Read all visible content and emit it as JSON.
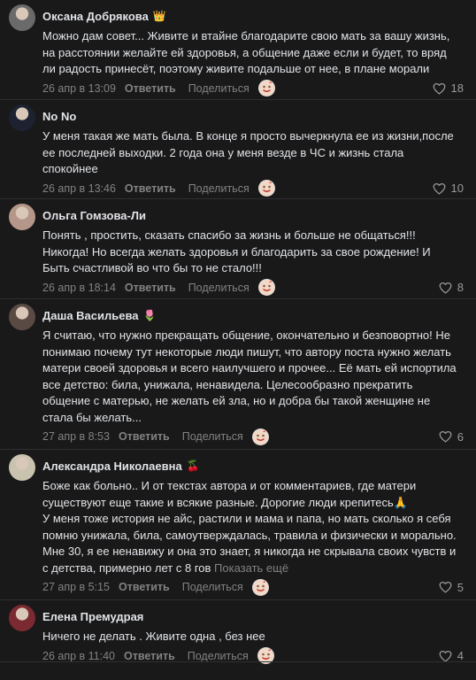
{
  "comments": [
    {
      "name": "Оксана Добрякова",
      "badge": "👑",
      "text": "Можно дам совет... Живите и втайне благодарите свою мать за вашу жизнь, на расстоянии желайте ей здоровья, а общение даже если и будет, то вряд ли радость принесёт, поэтому живите подальше от нее, в плане морали",
      "date": "26 апр в 13:09",
      "reply": "Ответить",
      "share": "Поделиться",
      "likes": "18",
      "avatar_color": "#6a6a6a"
    },
    {
      "name": "No No",
      "badge": "",
      "text": "У меня такая же мать была. В конце я просто вычеркнула ее из жизни,после ее последней выходки. 2 года она у меня везде в ЧС и жизнь стала спокойнее",
      "date": "26 апр в 13:46",
      "reply": "Ответить",
      "share": "Поделиться",
      "likes": "10",
      "avatar_color": "#1c2230"
    },
    {
      "name": "Ольга Гомзова-Ли",
      "badge": "",
      "text": "Понять , простить, сказать спасибо за жизнь и больше не общаться!!! Никогда! Но всегда желать здоровья и благодарить за свое рождение! И Быть счастливой во что бы то не стало!!!",
      "date": "26 апр в 18:14",
      "reply": "Ответить",
      "share": "Поделиться",
      "likes": "8",
      "avatar_color": "#b5978a"
    },
    {
      "name": "Даша Васильева",
      "badge": "🌷",
      "text": "Я считаю, что нужно прекращать общение, окончательно и безповортно! Не понимаю почему тут некоторые люди пишут, что автору поста нужно желать матери своей здоровья и всего наилучшего и прочее... Её мать ей испортила все детство: била, унижала, ненавидела. Целесообразно прекратить общение с матерью, не желать ей зла, но и добра бы такой женщине не стала бы желать...",
      "date": "27 апр в 8:53",
      "reply": "Ответить",
      "share": "Поделиться",
      "likes": "6",
      "avatar_color": "#5a4a44"
    },
    {
      "name": "Александра Николаевна",
      "badge": "🍒",
      "text": "Боже как больно.. И от текстах автора и от комментариев, где матери существуют еще такие и всякие разные. Дорогие люди крепитесь🙏\nУ меня тоже история не айс, растили и мама и папа, но мать сколько я себя помню унижала, била, самоутверждалась, травила и физически и морально. Мне 30, я ее ненавижу и она это знает, я никогда не скрывала своих чувств и с детства, примерно лет с 8 гов",
      "more": "Показать ещё",
      "date": "27 апр в 5:15",
      "reply": "Ответить",
      "share": "Поделиться",
      "likes": "5",
      "avatar_color": "#c9c2ae"
    },
    {
      "name": "Елена Премудрая",
      "badge": "",
      "text": "Ничего не делать . Живите одна , без нее",
      "date": "26 апр в 11:40",
      "reply": "Ответить",
      "share": "Поделиться",
      "likes": "4",
      "avatar_color": "#7a2a30"
    }
  ],
  "icons": {
    "heart": "heart-outline-icon",
    "reaction": "reaction-emoji-icon"
  }
}
